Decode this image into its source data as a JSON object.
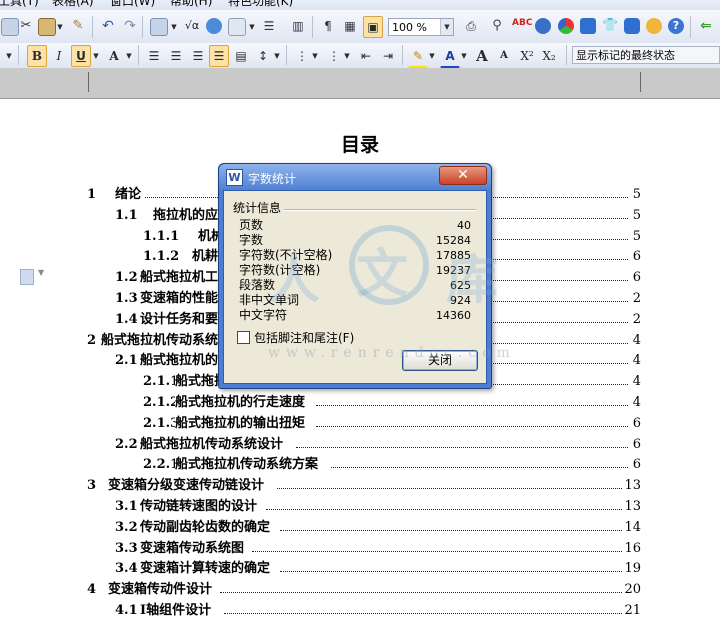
{
  "menubar": {
    "items": [
      "工具(T)",
      "表格(A)",
      "窗口(W)",
      "帮助(H)",
      "特色功能(K)"
    ]
  },
  "toolbar": {
    "zoom": "100 %",
    "track_changes_mode": "显示标记的最终状态",
    "bold_label": "B",
    "italic_label": "I",
    "underline_label": "U",
    "superscript_label": "X²",
    "subscript_label": "X₂",
    "grow_font_label": "A",
    "shrink_font_label": "A"
  },
  "document": {
    "title": "目录",
    "toc": [
      {
        "num": "1",
        "text": "绪论",
        "page": "5"
      },
      {
        "num": "1.1",
        "text": "拖拉机的应",
        "page": "5"
      },
      {
        "num": "1.1.1",
        "text": "机械",
        "page": "5"
      },
      {
        "num": "1.1.2",
        "text": "机耕",
        "page": "6"
      },
      {
        "num": "1.2",
        "text": "船式拖拉机工",
        "page": "6"
      },
      {
        "num": "1.3",
        "text": "变速箱的性能",
        "page": "2"
      },
      {
        "num": "1.4",
        "text": "设计任务和要",
        "page": "2"
      },
      {
        "num": "2",
        "text": "船式拖拉机传动系统",
        "page": "4"
      },
      {
        "num": "2.1",
        "text": "船式拖拉机的",
        "page": "4"
      },
      {
        "num": "2.1.1",
        "text": "船式拖拉",
        "page": "4"
      },
      {
        "num": "2.1.2",
        "text": "船式拖拉机的行走速度",
        "page": "4"
      },
      {
        "num": "2.1.3",
        "text": "船式拖拉机的输出扭矩",
        "page": "6"
      },
      {
        "num": "2.2",
        "text": "船式拖拉机传动系统设计",
        "page": "6"
      },
      {
        "num": "2.2.1",
        "text": "船式拖拉机传动系统方案",
        "page": "6"
      },
      {
        "num": "3",
        "text": "变速箱分级变速传动链设计",
        "page": "13"
      },
      {
        "num": "3.1",
        "text": "传动链转速图的设计",
        "page": "13"
      },
      {
        "num": "3.2",
        "text": "传动副齿轮齿数的确定",
        "page": "14"
      },
      {
        "num": "3.3",
        "text": "变速箱传动系统图",
        "page": "16"
      },
      {
        "num": "3.4",
        "text": "变速箱计算转速的确定",
        "page": "19"
      },
      {
        "num": "4",
        "text": "变速箱传动件设计",
        "page": "20"
      },
      {
        "num": "4.1",
        "text": "Ⅰ轴组件设计",
        "page": "21"
      }
    ]
  },
  "dialog": {
    "title": "字数统计",
    "group_label": "统计信息",
    "stats": [
      {
        "label": "页数",
        "value": "40"
      },
      {
        "label": "字数",
        "value": "15284"
      },
      {
        "label": "字符数(不计空格)",
        "value": "17885"
      },
      {
        "label": "字符数(计空格)",
        "value": "19237"
      },
      {
        "label": "段落数",
        "value": "625"
      },
      {
        "label": "非中文单词",
        "value": "924"
      },
      {
        "label": "中文字符",
        "value": "14360"
      }
    ],
    "checkbox_label": "包括脚注和尾注(F)",
    "checkbox_checked": false,
    "close_button": "关闭",
    "titlebar_close": "✕"
  },
  "watermark": {
    "chars": [
      "人",
      "文",
      "库"
    ],
    "url": "www.renrendoc.com"
  },
  "colors": {
    "dialog_frame": "#4d7ed1",
    "dialog_body": "#ece9d8",
    "toolbar_active": "#fbe3a8"
  }
}
